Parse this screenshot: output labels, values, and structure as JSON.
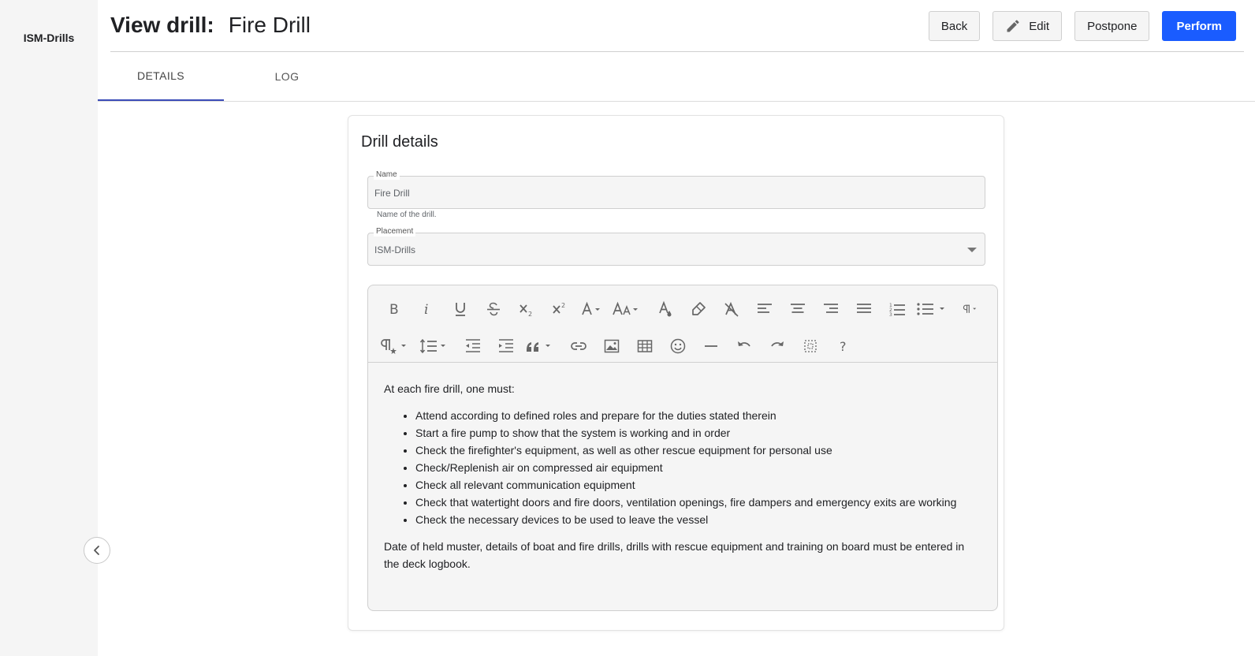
{
  "sidebar": {
    "brand": "ISM-Drills"
  },
  "header": {
    "title_label": "View drill:",
    "title_value": "Fire Drill"
  },
  "actions": {
    "back": "Back",
    "edit": "Edit",
    "postpone": "Postpone",
    "perform": "Perform"
  },
  "tabs": [
    {
      "label": "DETAILS",
      "active": true
    },
    {
      "label": "LOG",
      "active": false
    }
  ],
  "card": {
    "title": "Drill details",
    "name_field": {
      "label": "Name",
      "value": "Fire Drill",
      "helper": "Name of the drill."
    },
    "placement_field": {
      "label": "Placement",
      "value": "ISM-Drills"
    }
  },
  "editor": {
    "toolbar_icons": [
      "bold-icon",
      "italic-icon",
      "underline-icon",
      "strikethrough-icon",
      "subscript-icon",
      "superscript-icon",
      "font-family-icon",
      "font-size-icon",
      "text-color-icon",
      "highlight-icon",
      "clear-format-icon",
      "align-left-icon",
      "align-center-icon",
      "align-right-icon",
      "align-justify-icon",
      "ordered-list-icon",
      "unordered-list-icon",
      "paragraph-format-icon",
      "paragraph-style-icon",
      "line-height-icon",
      "outdent-icon",
      "indent-icon",
      "quote-icon",
      "link-icon",
      "image-icon",
      "table-icon",
      "emoticon-icon",
      "horizontal-line-icon",
      "undo-icon",
      "redo-icon",
      "select-all-icon",
      "help-icon"
    ],
    "intro": "At each fire drill, one must:",
    "items": [
      "Attend according to defined roles and prepare for the duties stated therein",
      "Start a fire pump to show that the system is working and in order",
      "Check the firefighter's equipment, as well as other rescue equipment for personal use",
      "Check/Replenish air on compressed air equipment",
      "Check all relevant communication equipment",
      "Check that watertight doors and fire doors, ventilation openings, fire dampers and emergency exits are working",
      "Check the necessary devices to be used to leave the vessel"
    ],
    "outro": "Date of held muster, details of boat and fire drills, drills with rescue equipment and training on board must be entered in the deck logbook."
  },
  "colors": {
    "primary": "#1a5cff",
    "tab_indicator": "#3b4cb8",
    "sidebar_bg": "#f5f5f5",
    "field_bg": "#f5f5f5"
  }
}
